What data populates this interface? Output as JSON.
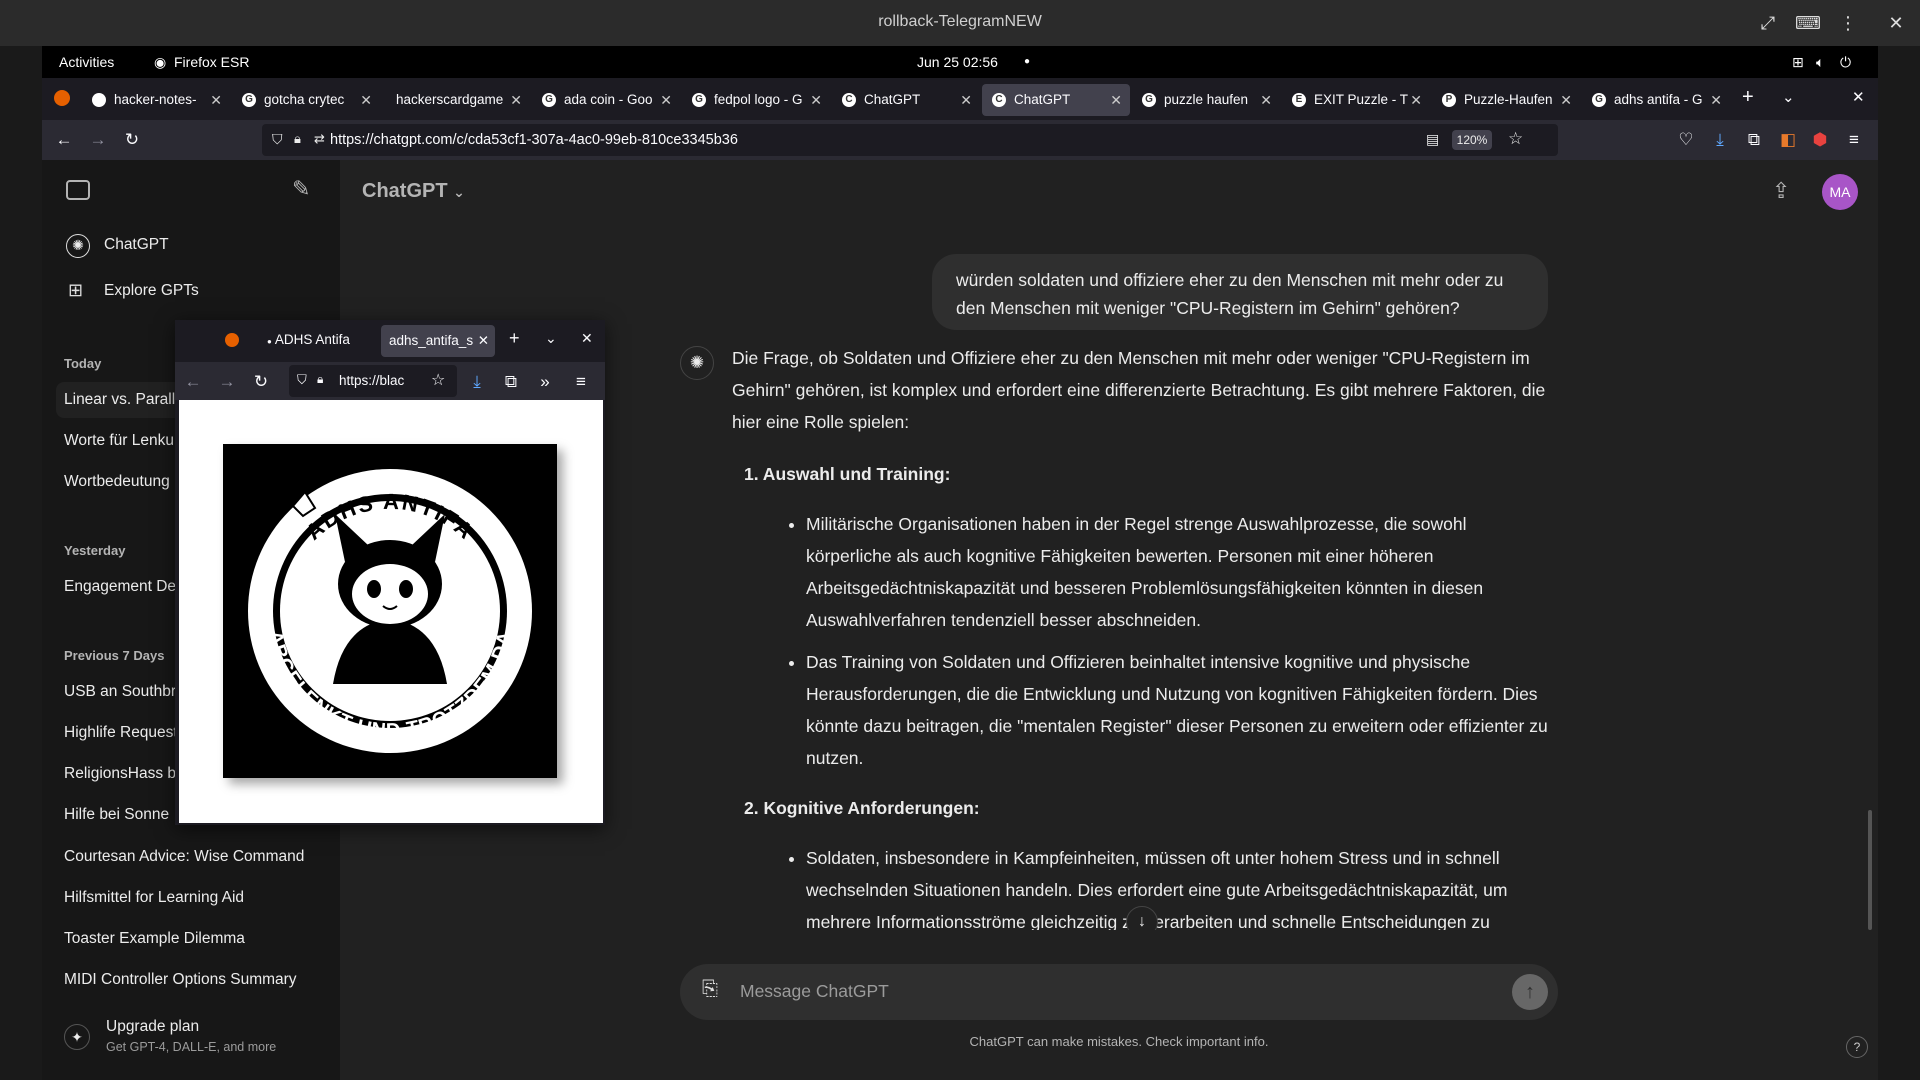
{
  "window": {
    "title": "rollback-TelegramNEW"
  },
  "gnome": {
    "activities": "Activities",
    "app": "Firefox ESR",
    "clock": "Jun 25  02:56"
  },
  "tabs": [
    {
      "label": "hacker-notes-",
      "fav": "G"
    },
    {
      "label": "gotcha crytec",
      "fav": "G"
    },
    {
      "label": "hackerscardgame",
      "fav": ""
    },
    {
      "label": "ada coin - Goo",
      "fav": "G"
    },
    {
      "label": "fedpol logo - G",
      "fav": "G"
    },
    {
      "label": "ChatGPT",
      "fav": "C"
    },
    {
      "label": "ChatGPT",
      "fav": "C"
    },
    {
      "label": "puzzle haufen",
      "fav": "G"
    },
    {
      "label": "EXIT Puzzle - T",
      "fav": "E"
    },
    {
      "label": "Puzzle-Haufen",
      "fav": "P"
    },
    {
      "label": "adhs antifa - G",
      "fav": "G"
    }
  ],
  "navbar": {
    "url": "https://chatgpt.com/c/cda53cf1-307a-4ac0-99eb-810ce3345b36",
    "zoom": "120%"
  },
  "sidebar": {
    "top_items": [
      {
        "label": "ChatGPT"
      },
      {
        "label": "Explore GPTs"
      }
    ],
    "today": {
      "heading": "Today",
      "items": [
        "Linear vs. Parallel",
        "Worte für Lenkung",
        "Wortbedeutung"
      ]
    },
    "yesterday": {
      "heading": "Yesterday",
      "items": [
        "Engagement Details"
      ]
    },
    "prev7": {
      "heading": "Previous 7 Days",
      "items": [
        "USB an Southbridge",
        "Highlife Request",
        "ReligionsHass b",
        "Hilfe bei Sonne",
        "Courtesan Advice: Wise Command",
        "Hilfsmittel for Learning Aid",
        "Toaster Example Dilemma",
        "MIDI Controller Options Summary"
      ]
    },
    "upgrade": {
      "title": "Upgrade plan",
      "subtitle": "Get GPT-4, DALL-E, and more"
    }
  },
  "main": {
    "model": "ChatGPT",
    "avatar": "MA",
    "user_message": "würden soldaten und offiziere eher zu den Menschen mit mehr oder zu den Menschen mit weniger \"CPU-Registern im Gehirn\" gehören?",
    "intro": "Die Frage, ob Soldaten und Offiziere eher zu den Menschen mit mehr oder weniger \"CPU-Registern im Gehirn\" gehören, ist komplex und erfordert eine differenzierte Betrachtung. Es gibt mehrere Faktoren, die hier eine Rolle spielen:",
    "section1": {
      "title": "1.  Auswahl und Training:",
      "bullets": [
        "Militärische Organisationen haben in der Regel strenge Auswahlprozesse, die sowohl körperliche als auch kognitive Fähigkeiten bewerten. Personen mit einer höheren Arbeitsgedächtniskapazität und besseren Problemlösungsfähigkeiten könnten in diesen Auswahlverfahren tendenziell besser abschneiden.",
        "Das Training von Soldaten und Offizieren beinhaltet intensive kognitive und physische Herausforderungen, die die Entwicklung und Nutzung von kognitiven Fähigkeiten fördern. Dies könnte dazu beitragen, die \"mentalen Register\" dieser Personen zu erweitern oder effizienter zu nutzen."
      ]
    },
    "section2": {
      "title": "2.  Kognitive Anforderungen:",
      "bullets": [
        "Soldaten, insbesondere in Kampfeinheiten, müssen oft unter hohem Stress und in schnell wechselnden Situationen handeln. Dies erfordert eine gute Arbeitsgedächtniskapazität, um mehrere Informationsströme gleichzeitig zu verarbeiten und schnelle Entscheidungen zu"
      ]
    },
    "composer_placeholder": "Message ChatGPT",
    "disclaimer": "ChatGPT can make mistakes. Check important info."
  },
  "popup": {
    "tabs": [
      "ADHS Antifa",
      "adhs_antifa_s"
    ],
    "url": "https://blac",
    "logo_text_top": "ADHS ANTIFA",
    "logo_text_bottom": "ABGELENKT UND TROTZDEM DA"
  }
}
